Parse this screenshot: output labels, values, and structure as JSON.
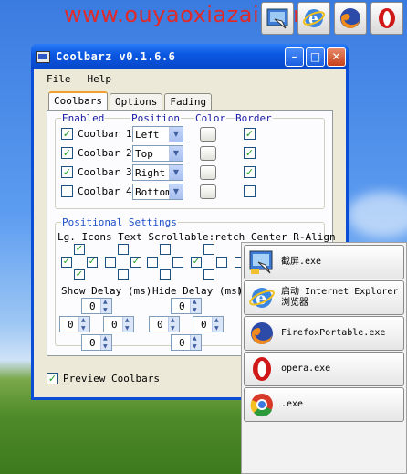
{
  "watermark": "www.ouyaoxiazai.com",
  "top_coolbar": [
    "screenshot-icon",
    "internet-explorer-icon",
    "firefox-icon",
    "opera-icon"
  ],
  "window": {
    "title": "Coolbarz v0.1.6.6",
    "menu": [
      "File",
      "Help"
    ],
    "tabs": [
      "Coolbars",
      "Options",
      "Fading"
    ],
    "enabled_group": {
      "headers": {
        "enabled": "Enabled",
        "position": "Position",
        "color": "Color",
        "border": "Border"
      },
      "rows": [
        {
          "label": "Coolbar 1",
          "enabled": true,
          "position": "Left",
          "border": true
        },
        {
          "label": "Coolbar 2",
          "enabled": true,
          "position": "Top",
          "border": true
        },
        {
          "label": "Coolbar 3",
          "enabled": true,
          "position": "Right",
          "border": true
        },
        {
          "label": "Coolbar 4",
          "enabled": false,
          "position": "Bottom",
          "border": false
        }
      ]
    },
    "positional": {
      "title": "Positional Settings",
      "col_headers": "Lg. Icons Text  Scrollable:retch Center  R-Align",
      "show_delay": "Show Delay (ms)",
      "hide_delay": "Hide Delay (ms)",
      "hide_delay_cut": "M",
      "spin_value": "0"
    },
    "preview": {
      "label": "Preview Coolbars",
      "checked": true
    }
  },
  "side_coolbar": {
    "items": [
      {
        "icon": "screenshot-icon",
        "label": "截屏.exe"
      },
      {
        "icon": "internet-explorer-icon",
        "label": "启动 Internet Explorer 浏览器"
      },
      {
        "icon": "firefox-icon",
        "label": "FirefoxPortable.exe"
      },
      {
        "icon": "opera-icon",
        "label": "opera.exe"
      },
      {
        "icon": "chrome-icon",
        "label": ".exe"
      }
    ]
  },
  "colors": {
    "title_blue": "#0b58e2",
    "label_blue": "#1a1aa0",
    "group_blue": "#2050c8",
    "watermark_red": "#e02a2a",
    "check_green": "#21a121"
  }
}
